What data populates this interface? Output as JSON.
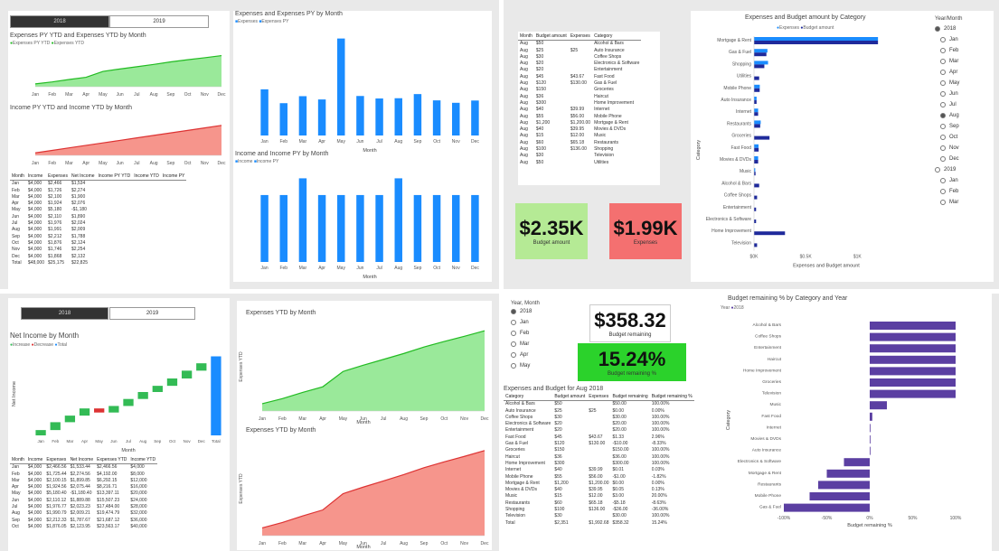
{
  "colors": {
    "green": "#8fe78f",
    "greenLine": "#22bb22",
    "red": "#f58a80",
    "redLine": "#dd3333",
    "blue": "#1a8cff",
    "navy": "#1f2a9b",
    "purple": "#5b3fa2",
    "kpiGreen": "#b5ea95",
    "kpiRed": "#f47070",
    "kpiBright": "#2bd22b"
  },
  "q1": {
    "year_tabs": [
      "2018",
      "2019"
    ],
    "exp_title": "Expenses PY YTD and Expenses YTD by Month",
    "exp_legend": [
      "Expenses PY YTD",
      "Expenses YTD"
    ],
    "inc_title": "Income PY YTD and Income YTD by Month",
    "exp_month_title": "Expenses and Expenses PY by Month",
    "exp_month_legend": [
      "Expenses",
      "Expenses PY"
    ],
    "inc_month_title": "Income and Income PY by Month",
    "inc_month_legend": [
      "Income",
      "Income PY"
    ],
    "months": [
      "Jan",
      "Feb",
      "Mar",
      "Apr",
      "May",
      "Jun",
      "Jul",
      "Aug",
      "Sep",
      "Oct",
      "Nov",
      "Dec"
    ],
    "x_label": "Month",
    "table_head": [
      "Month",
      "Income",
      "Expenses",
      "Net Income",
      "Income PY YTD",
      "Income YTD",
      "Income PY"
    ],
    "table_rows": [
      [
        "Jan",
        "$4,000",
        "$2,466",
        "$1,534"
      ],
      [
        "Feb",
        "$4,000",
        "$1,726",
        "$2,274"
      ],
      [
        "Mar",
        "$4,000",
        "$2,100",
        "$1,900"
      ],
      [
        "Apr",
        "$4,000",
        "$1,924",
        "$2,076"
      ],
      [
        "May",
        "$4,000",
        "$5,180",
        "-$1,180"
      ],
      [
        "Jun",
        "$4,000",
        "$2,110",
        "$1,890"
      ],
      [
        "Jul",
        "$4,000",
        "$1,976",
        "$2,024"
      ],
      [
        "Aug",
        "$4,000",
        "$1,991",
        "$2,009"
      ],
      [
        "Sep",
        "$4,000",
        "$2,212",
        "$1,788"
      ],
      [
        "Oct",
        "$4,000",
        "$1,876",
        "$2,124"
      ],
      [
        "Nov",
        "$4,000",
        "$1,746",
        "$2,254"
      ],
      [
        "Dec",
        "$4,000",
        "$1,868",
        "$2,132"
      ],
      [
        "Total",
        "$48,000",
        "$25,175",
        "$22,825"
      ]
    ]
  },
  "q2": {
    "table_head": [
      "Month",
      "Budget amount",
      "Expenses",
      "Category"
    ],
    "table_rows": [
      [
        "Aug",
        "$50",
        "",
        "Alcohol & Bars"
      ],
      [
        "Aug",
        "$25",
        "$25",
        "Auto Insurance"
      ],
      [
        "Aug",
        "$30",
        "",
        "Coffee Shops"
      ],
      [
        "Aug",
        "$20",
        "",
        "Electronics & Software"
      ],
      [
        "Aug",
        "$20",
        "",
        "Entertainment"
      ],
      [
        "Aug",
        "$45",
        "$43.67",
        "Fast Food"
      ],
      [
        "Aug",
        "$120",
        "$130.00",
        "Gas & Fuel"
      ],
      [
        "Aug",
        "$150",
        "",
        "Groceries"
      ],
      [
        "Aug",
        "$36",
        "",
        "Haircut"
      ],
      [
        "Aug",
        "$300",
        "",
        "Home Improvement"
      ],
      [
        "Aug",
        "$40",
        "$39.99",
        "Internet"
      ],
      [
        "Aug",
        "$55",
        "$56.00",
        "Mobile Phone"
      ],
      [
        "Aug",
        "$1,200",
        "$1,200.00",
        "Mortgage & Rent"
      ],
      [
        "Aug",
        "$40",
        "$39.95",
        "Movies & DVDs"
      ],
      [
        "Aug",
        "$15",
        "$12.00",
        "Music"
      ],
      [
        "Aug",
        "$60",
        "$65.18",
        "Restaurants"
      ],
      [
        "Aug",
        "$100",
        "$136.00",
        "Shopping"
      ],
      [
        "Aug",
        "$30",
        "",
        "Television"
      ],
      [
        "Aug",
        "$50",
        "",
        "Utilities"
      ]
    ],
    "kpi_budget": {
      "value": "$2.35K",
      "label": "Budget amount"
    },
    "kpi_expenses": {
      "value": "$1.99K",
      "label": "Expenses"
    },
    "bar_title": "Expenses and Budget amount by Category",
    "bar_legend": [
      "Expenses",
      "Budget amount"
    ],
    "bar_categories": [
      "Mortgage & Rent",
      "Gas & Fuel",
      "Shopping",
      "Utilities",
      "Mobile Phone",
      "Auto Insurance",
      "Internet",
      "Restaurants",
      "Groceries",
      "Fast Food",
      "Movies & DVDs",
      "Music",
      "Alcohol & Bars",
      "Coffee Shops",
      "Entertainment",
      "Electronics & Software",
      "Home Improvement",
      "Television"
    ],
    "y_label": "Category",
    "x_label": "Expenses and Budget amount",
    "x_ticks": [
      "$0K",
      "$0.5K",
      "$1K"
    ],
    "slicer_title": "Year/Month",
    "slicer_items": [
      {
        "label": "2018",
        "sel": true,
        "year": true
      },
      {
        "label": "Jan"
      },
      {
        "label": "Feb"
      },
      {
        "label": "Mar"
      },
      {
        "label": "Apr"
      },
      {
        "label": "May"
      },
      {
        "label": "Jun"
      },
      {
        "label": "Jul"
      },
      {
        "label": "Aug",
        "sel": true
      },
      {
        "label": "Sep"
      },
      {
        "label": "Oct"
      },
      {
        "label": "Nov"
      },
      {
        "label": "Dec"
      },
      {
        "label": "2019",
        "year": true
      },
      {
        "label": "Jan"
      },
      {
        "label": "Feb"
      },
      {
        "label": "Mar"
      }
    ]
  },
  "q3": {
    "year_tabs": [
      "2018",
      "2019"
    ],
    "wf_title": "Net Income by Month",
    "wf_legend": [
      "Increase",
      "Decrease",
      "Total"
    ],
    "wf_y_label": "Net Income",
    "wf_x_label": "Month",
    "wf_categories": [
      "Jan",
      "Feb",
      "Mar",
      "Apr",
      "May",
      "Jun",
      "Jul",
      "Aug",
      "Sep",
      "Oct",
      "Nov",
      "Dec",
      "Total"
    ],
    "exp_ytd_title": "Expenses YTD by Month",
    "exp_ytd_ylabel": "Expenses YTD",
    "inc_ytd_title": "Expenses YTD by Month",
    "inc_ytd_ylabel": "Expenses YTD",
    "x_label": "Month",
    "table_head": [
      "Month",
      "Income",
      "Expenses",
      "Net Income",
      "Expenses YTD",
      "Income YTD"
    ],
    "table_rows": [
      [
        "Jan",
        "$4,000",
        "$2,466.56",
        "$1,533.44",
        "$2,466.56",
        "$4,000"
      ],
      [
        "Feb",
        "$4,000",
        "$1,725.44",
        "$2,274.56",
        "$4,192.00",
        "$8,000"
      ],
      [
        "Mar",
        "$4,000",
        "$2,100.15",
        "$1,899.85",
        "$6,292.15",
        "$12,000"
      ],
      [
        "Apr",
        "$4,000",
        "$1,924.56",
        "$2,075.44",
        "$8,216.71",
        "$16,000"
      ],
      [
        "May",
        "$4,000",
        "$5,180.40",
        "-$1,180.40",
        "$13,397.11",
        "$20,000"
      ],
      [
        "Jun",
        "$4,000",
        "$2,110.12",
        "$1,889.88",
        "$15,507.23",
        "$24,000"
      ],
      [
        "Jul",
        "$4,000",
        "$1,976.77",
        "$2,023.23",
        "$17,484.00",
        "$28,000"
      ],
      [
        "Aug",
        "$4,000",
        "$1,990.79",
        "$2,009.21",
        "$19,474.79",
        "$32,000"
      ],
      [
        "Sep",
        "$4,000",
        "$2,212.33",
        "$1,787.67",
        "$21,687.12",
        "$36,000"
      ],
      [
        "Oct",
        "$4,000",
        "$1,876.05",
        "$2,123.95",
        "$23,563.17",
        "$40,000"
      ]
    ]
  },
  "q4": {
    "slicer_title": "Year, Month",
    "slicer_items": [
      {
        "label": "2018",
        "sel": true
      },
      {
        "label": "Jan"
      },
      {
        "label": "Feb"
      },
      {
        "label": "Mar"
      },
      {
        "label": "Apr"
      },
      {
        "label": "May"
      }
    ],
    "kpi_remaining": {
      "value": "$358.32",
      "label": "Budget remaining"
    },
    "kpi_pct": {
      "value": "15.24%",
      "label": "Budget remaining %"
    },
    "table_title": "Expenses and Budget for Aug 2018",
    "table_head": [
      "Category",
      "Budget amount",
      "Expenses",
      "Budget remaining",
      "Budget remaining %"
    ],
    "table_rows": [
      [
        "Alcohol & Bars",
        "$50",
        "",
        "$50.00",
        "100.00%"
      ],
      [
        "Auto Insurance",
        "$25",
        "$25",
        "$0.00",
        "0.00%"
      ],
      [
        "Coffee Shops",
        "$30",
        "",
        "$30.00",
        "100.00%"
      ],
      [
        "Electronics & Software",
        "$20",
        "",
        "$20.00",
        "100.00%"
      ],
      [
        "Entertainment",
        "$20",
        "",
        "$20.00",
        "100.00%"
      ],
      [
        "Fast Food",
        "$45",
        "$43.67",
        "$1.33",
        "2.96%"
      ],
      [
        "Gas & Fuel",
        "$120",
        "$130.00",
        "-$10.00",
        "-8.33%"
      ],
      [
        "Groceries",
        "$150",
        "",
        "$150.00",
        "100.00%"
      ],
      [
        "Haircut",
        "$36",
        "",
        "$36.00",
        "100.00%"
      ],
      [
        "Home Improvement",
        "$300",
        "",
        "$300.00",
        "100.00%"
      ],
      [
        "Internet",
        "$40",
        "$39.99",
        "$0.01",
        "0.03%"
      ],
      [
        "Mobile Phone",
        "$55",
        "$56.00",
        "-$1.00",
        "-1.82%"
      ],
      [
        "Mortgage & Rent",
        "$1,200",
        "$1,200.00",
        "$0.00",
        "0.00%"
      ],
      [
        "Movies & DVDs",
        "$40",
        "$39.95",
        "$0.05",
        "0.13%"
      ],
      [
        "Music",
        "$15",
        "$12.00",
        "$3.00",
        "20.00%"
      ],
      [
        "Restaurants",
        "$60",
        "$65.18",
        "-$5.18",
        "-8.63%"
      ],
      [
        "Shopping",
        "$100",
        "$136.00",
        "-$36.00",
        "-36.00%"
      ],
      [
        "Television",
        "$30",
        "",
        "$30.00",
        "100.00%"
      ]
    ],
    "table_total": [
      "Total",
      "$2,351",
      "$1,992.68",
      "$358.32",
      "15.24%"
    ],
    "bar_title": "Budget remaining % by Category and Year",
    "bar_legend": [
      "Year",
      "2018"
    ],
    "bar_categories": [
      "Alcohol & Bars",
      "Coffee Shops",
      "Entertainment",
      "Haircut",
      "Home Improvement",
      "Groceries",
      "Television",
      "Music",
      "Fast Food",
      "Internet",
      "Movies & DVDs",
      "Auto Insurance",
      "Electronics & Software",
      "Mortgage & Rent",
      "Restaurants",
      "Mobile Phone",
      "Gas & Fuel"
    ],
    "y_label": "Category",
    "x_label": "Budget remaining %",
    "x_ticks": [
      "-100%",
      "-50%",
      "0%",
      "50%",
      "100%"
    ]
  },
  "chart_data": [
    {
      "type": "area",
      "title": "Expenses PY YTD and Expenses YTD by Month",
      "categories": [
        "Jan",
        "Feb",
        "Mar",
        "Apr",
        "May",
        "Jun",
        "Jul",
        "Aug",
        "Sep",
        "Oct",
        "Nov",
        "Dec"
      ],
      "series": [
        {
          "name": "Expenses YTD",
          "values": [
            2466,
            4192,
            6292,
            8217,
            13397,
            15507,
            17484,
            19475,
            21687,
            23563,
            25309,
            27177
          ]
        }
      ]
    },
    {
      "type": "area",
      "title": "Income PY YTD and Income YTD by Month",
      "categories": [
        "Jan",
        "Feb",
        "Mar",
        "Apr",
        "May",
        "Jun",
        "Jul",
        "Aug",
        "Sep",
        "Oct",
        "Nov",
        "Dec"
      ],
      "series": [
        {
          "name": "Income YTD",
          "values": [
            4000,
            8000,
            12000,
            16000,
            20000,
            24000,
            28000,
            32000,
            36000,
            40000,
            44000,
            48000
          ]
        }
      ]
    },
    {
      "type": "bar",
      "title": "Expenses and Expenses PY by Month",
      "categories": [
        "Jan",
        "Feb",
        "Mar",
        "Apr",
        "May",
        "Jun",
        "Jul",
        "Aug",
        "Sep",
        "Oct",
        "Nov",
        "Dec"
      ],
      "series": [
        {
          "name": "Expenses",
          "values": [
            2466,
            1726,
            2100,
            1925,
            5180,
            2110,
            1977,
            1991,
            2212,
            1876,
            1746,
            1868
          ]
        }
      ]
    },
    {
      "type": "bar",
      "title": "Income and Income PY by Month",
      "categories": [
        "Jan",
        "Feb",
        "Mar",
        "Apr",
        "May",
        "Jun",
        "Jul",
        "Aug",
        "Sep",
        "Oct",
        "Nov",
        "Dec"
      ],
      "series": [
        {
          "name": "Income",
          "values": [
            4000,
            4000,
            5000,
            4000,
            4000,
            4000,
            4000,
            5000,
            4000,
            4000,
            4000,
            4000
          ]
        }
      ]
    },
    {
      "type": "bar",
      "title": "Expenses and Budget amount by Category",
      "categories": [
        "Mortgage & Rent",
        "Gas & Fuel",
        "Shopping",
        "Utilities",
        "Mobile Phone",
        "Auto Insurance",
        "Internet",
        "Restaurants",
        "Groceries",
        "Fast Food",
        "Movies & DVDs",
        "Music",
        "Alcohol & Bars",
        "Coffee Shops",
        "Entertainment",
        "Electronics & Software",
        "Home Improvement",
        "Television"
      ],
      "series": [
        {
          "name": "Expenses",
          "values": [
            1200,
            130,
            136,
            0,
            56,
            25,
            40,
            65,
            0,
            44,
            40,
            12,
            0,
            0,
            0,
            0,
            0,
            0
          ]
        },
        {
          "name": "Budget amount",
          "values": [
            1200,
            120,
            100,
            50,
            55,
            25,
            40,
            60,
            150,
            45,
            40,
            15,
            50,
            30,
            20,
            20,
            300,
            30
          ]
        }
      ]
    },
    {
      "type": "bar",
      "title": "Net Income by Month",
      "categories": [
        "Jan",
        "Feb",
        "Mar",
        "Apr",
        "May",
        "Jun",
        "Jul",
        "Aug",
        "Sep",
        "Oct",
        "Nov",
        "Dec",
        "Total"
      ],
      "values": [
        1533,
        2275,
        1900,
        2075,
        -1180,
        1890,
        2023,
        2009,
        1788,
        2124,
        2254,
        2132,
        22825
      ]
    },
    {
      "type": "area",
      "title": "Expenses YTD by Month",
      "categories": [
        "Jan",
        "Feb",
        "Mar",
        "Apr",
        "May",
        "Jun",
        "Jul",
        "Aug",
        "Sep",
        "Oct",
        "Nov",
        "Dec"
      ],
      "values": [
        2466,
        4192,
        6292,
        8217,
        13397,
        15507,
        17484,
        19475,
        21687,
        23563,
        25309,
        27177
      ]
    },
    {
      "type": "area",
      "title": "Expenses YTD by Month",
      "categories": [
        "Jan",
        "Feb",
        "Mar",
        "Apr",
        "May",
        "Jun",
        "Jul",
        "Aug",
        "Sep",
        "Oct",
        "Nov",
        "Dec"
      ],
      "values": [
        2466,
        4192,
        6292,
        8217,
        13397,
        15507,
        17484,
        19475,
        21687,
        23563,
        25309,
        27177
      ]
    },
    {
      "type": "bar",
      "title": "Budget remaining % by Category and Year",
      "categories": [
        "Alcohol & Bars",
        "Coffee Shops",
        "Entertainment",
        "Haircut",
        "Home Improvement",
        "Groceries",
        "Television",
        "Music",
        "Fast Food",
        "Internet",
        "Movies & DVDs",
        "Auto Insurance",
        "Electronics & Software",
        "Mortgage & Rent",
        "Restaurants",
        "Mobile Phone",
        "Gas & Fuel"
      ],
      "values": [
        100,
        100,
        100,
        100,
        100,
        100,
        100,
        20,
        3,
        0,
        0,
        0,
        -30,
        -50,
        -60,
        -70,
        -100
      ]
    }
  ]
}
